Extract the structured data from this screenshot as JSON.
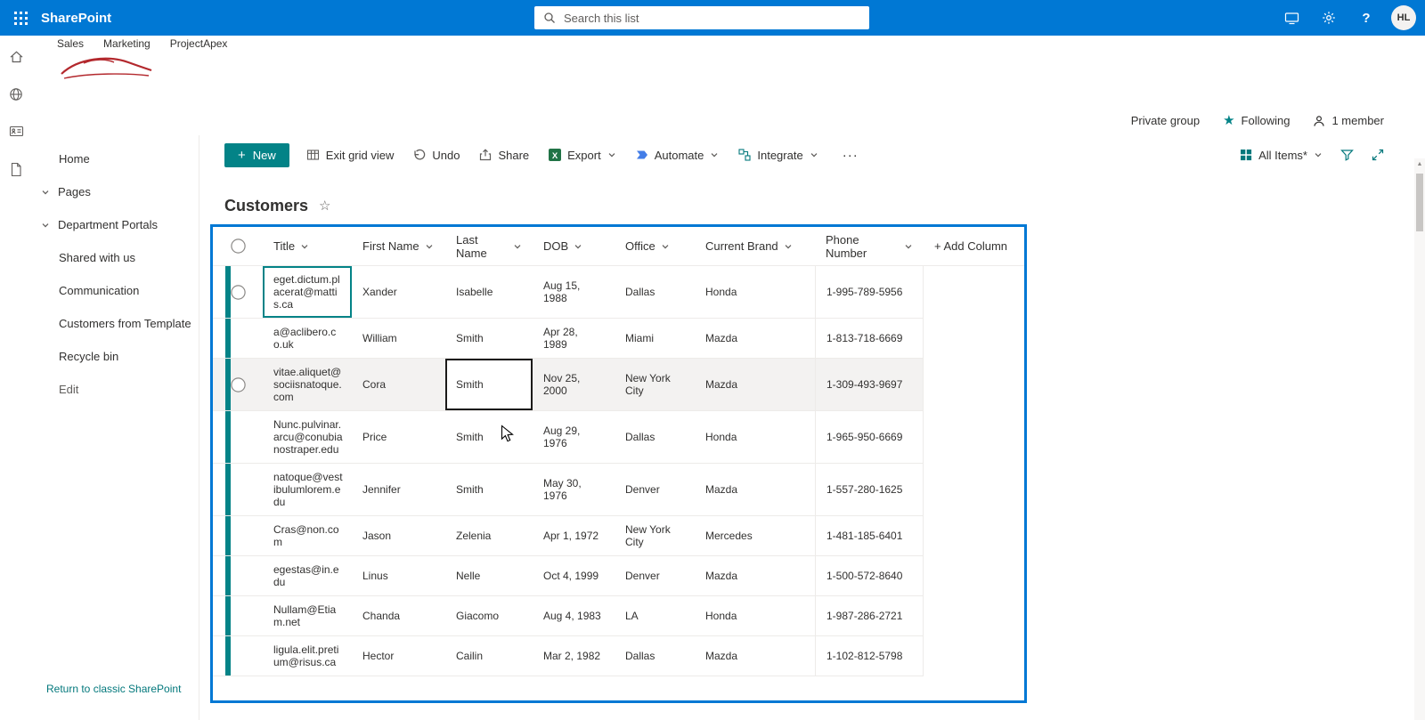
{
  "topbar": {
    "app_name": "SharePoint",
    "search_placeholder": "Search this list",
    "avatar_initials": "HL"
  },
  "site_header": {
    "nav_links": [
      "Sales",
      "Marketing",
      "ProjectApex"
    ],
    "privacy_label": "Private group",
    "following_label": "Following",
    "members_label": "1 member"
  },
  "sidebar": {
    "items": [
      {
        "label": "Home",
        "expandable": false
      },
      {
        "label": "Pages",
        "expandable": true
      },
      {
        "label": "Department Portals",
        "expandable": true
      },
      {
        "label": "Shared with us",
        "expandable": false
      },
      {
        "label": "Communication",
        "expandable": false
      },
      {
        "label": "Customers from Template",
        "expandable": false
      },
      {
        "label": "Recycle bin",
        "expandable": false
      },
      {
        "label": "Edit",
        "expandable": false
      }
    ],
    "footer_link": "Return to classic SharePoint"
  },
  "command_bar": {
    "new_label": "New",
    "items": [
      {
        "label": "Exit grid view",
        "icon": "grid-icon",
        "chevron": false
      },
      {
        "label": "Undo",
        "icon": "undo-icon",
        "chevron": false
      },
      {
        "label": "Share",
        "icon": "share-icon",
        "chevron": false
      },
      {
        "label": "Export",
        "icon": "excel-icon",
        "chevron": true
      },
      {
        "label": "Automate",
        "icon": "flow-icon",
        "chevron": true
      },
      {
        "label": "Integrate",
        "icon": "integrate-icon",
        "chevron": true
      }
    ],
    "overflow_label": "···",
    "view_label": "All Items*"
  },
  "page": {
    "title": "Customers"
  },
  "grid": {
    "columns": [
      "Title",
      "First Name",
      "Last Name",
      "DOB",
      "Office",
      "Current Brand",
      "Phone Number"
    ],
    "add_column_label": "+ Add Column",
    "rows": [
      {
        "title": "eget.dictum.placerat@mattis.ca",
        "first_name": "Xander",
        "last_name": "Isabelle",
        "dob": "Aug 15, 1988",
        "office": "Dallas",
        "current_brand": "Honda",
        "phone": "1-995-789-5956",
        "show_checkbox": true,
        "title_cell_selected": true,
        "last_cell_selected": false,
        "row_highlighted": false
      },
      {
        "title": "a@aclibero.co.uk",
        "first_name": "William",
        "last_name": "Smith",
        "dob": "Apr 28, 1989",
        "office": "Miami",
        "current_brand": "Mazda",
        "phone": "1-813-718-6669",
        "show_checkbox": false,
        "title_cell_selected": false,
        "last_cell_selected": false,
        "row_highlighted": false
      },
      {
        "title": "vitae.aliquet@sociisnatoque.com",
        "first_name": "Cora",
        "last_name": "Smith",
        "dob": "Nov 25, 2000",
        "office": "New York City",
        "current_brand": "Mazda",
        "phone": "1-309-493-9697",
        "show_checkbox": true,
        "title_cell_selected": false,
        "last_cell_selected": true,
        "row_highlighted": true
      },
      {
        "title": "Nunc.pulvinar.arcu@conubianostraper.edu",
        "first_name": "Price",
        "last_name": "Smith",
        "dob": "Aug 29, 1976",
        "office": "Dallas",
        "current_brand": "Honda",
        "phone": "1-965-950-6669",
        "show_checkbox": false,
        "title_cell_selected": false,
        "last_cell_selected": false,
        "row_highlighted": false
      },
      {
        "title": "natoque@vestibulumlorem.edu",
        "first_name": "Jennifer",
        "last_name": "Smith",
        "dob": "May 30, 1976",
        "office": "Denver",
        "current_brand": "Mazda",
        "phone": "1-557-280-1625",
        "show_checkbox": false,
        "title_cell_selected": false,
        "last_cell_selected": false,
        "row_highlighted": false
      },
      {
        "title": "Cras@non.com",
        "first_name": "Jason",
        "last_name": "Zelenia",
        "dob": "Apr 1, 1972",
        "office": "New York City",
        "current_brand": "Mercedes",
        "phone": "1-481-185-6401",
        "show_checkbox": false,
        "title_cell_selected": false,
        "last_cell_selected": false,
        "row_highlighted": false
      },
      {
        "title": "egestas@in.edu",
        "first_name": "Linus",
        "last_name": "Nelle",
        "dob": "Oct 4, 1999",
        "office": "Denver",
        "current_brand": "Mazda",
        "phone": "1-500-572-8640",
        "show_checkbox": false,
        "title_cell_selected": false,
        "last_cell_selected": false,
        "row_highlighted": false
      },
      {
        "title": "Nullam@Etiam.net",
        "first_name": "Chanda",
        "last_name": "Giacomo",
        "dob": "Aug 4, 1983",
        "office": "LA",
        "current_brand": "Honda",
        "phone": "1-987-286-2721",
        "show_checkbox": false,
        "title_cell_selected": false,
        "last_cell_selected": false,
        "row_highlighted": false
      },
      {
        "title": "ligula.elit.pretium@risus.ca",
        "first_name": "Hector",
        "last_name": "Cailin",
        "dob": "Mar 2, 1982",
        "office": "Dallas",
        "current_brand": "Mazda",
        "phone": "1-102-812-5798",
        "show_checkbox": false,
        "title_cell_selected": false,
        "last_cell_selected": false,
        "row_highlighted": false
      }
    ]
  },
  "colors": {
    "topbar_blue": "#0078d4",
    "accent_teal": "#038387",
    "grid_border_blue": "#0078d4",
    "excel_green": "#217346",
    "row_highlight": "#f3f2f1",
    "divider": "#edebe9",
    "text": "#323130",
    "text_secondary": "#605e5c"
  }
}
